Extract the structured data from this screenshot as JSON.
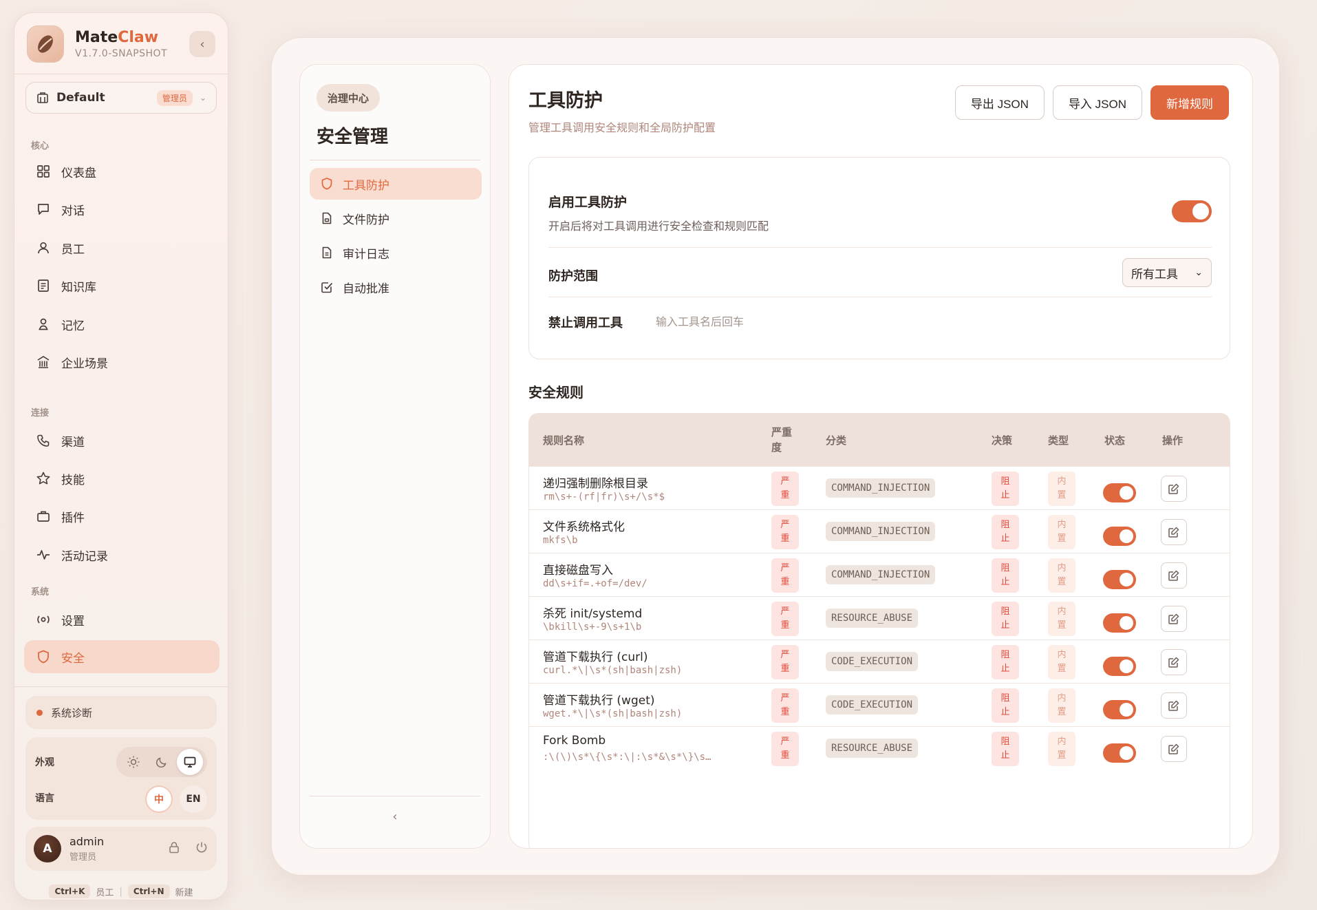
{
  "brand": {
    "name_a": "Mate",
    "name_b": "Claw",
    "version": "V1.7.0-SNAPSHOT"
  },
  "workspace": {
    "name": "Default",
    "badge": "管理员"
  },
  "nav": {
    "section_core": "核心",
    "section_connect": "连接",
    "section_system": "系统",
    "items": [
      {
        "label": "仪表盘",
        "icon": "grid-icon"
      },
      {
        "label": "对话",
        "icon": "chat-icon"
      },
      {
        "label": "员工",
        "icon": "person-icon"
      },
      {
        "label": "知识库",
        "icon": "book-icon"
      },
      {
        "label": "记忆",
        "icon": "memory-icon"
      },
      {
        "label": "企业场景",
        "icon": "building-icon"
      },
      {
        "label": "渠道",
        "icon": "phone-icon"
      },
      {
        "label": "技能",
        "icon": "star-icon"
      },
      {
        "label": "插件",
        "icon": "plugin-icon"
      },
      {
        "label": "活动记录",
        "icon": "activity-icon"
      },
      {
        "label": "设置",
        "icon": "settings-icon"
      },
      {
        "label": "安全",
        "icon": "shield-icon"
      }
    ]
  },
  "diagnostics": {
    "label": "系统诊断"
  },
  "prefs": {
    "appearance_label": "外观",
    "language_label": "语言",
    "lang_zh": "中",
    "lang_en": "EN"
  },
  "user": {
    "initial": "A",
    "name": "admin",
    "role": "管理员"
  },
  "shortcuts": {
    "k1": "Ctrl+K",
    "k1_label": "员工",
    "k2": "Ctrl+N",
    "k2_label": "新建"
  },
  "subnav": {
    "chip": "治理中心",
    "title": "安全管理",
    "items": [
      {
        "label": "工具防护"
      },
      {
        "label": "文件防护"
      },
      {
        "label": "审计日志"
      },
      {
        "label": "自动批准"
      }
    ]
  },
  "page": {
    "title": "工具防护",
    "subtitle": "管理工具调用安全规则和全局防护配置",
    "export_label": "导出 JSON",
    "import_label": "导入 JSON",
    "add_label": "新增规则"
  },
  "settings": {
    "enable_title": "启用工具防护",
    "enable_desc": "开启后将对工具调用进行安全检查和规则匹配",
    "scope_label": "防护范围",
    "scope_value": "所有工具",
    "ban_label": "禁止调用工具",
    "ban_placeholder": "输入工具名后回车"
  },
  "rules": {
    "title": "安全规则",
    "columns": {
      "name": "规则名称",
      "severity_a": "严重",
      "severity_b": "度",
      "category": "分类",
      "decision": "决策",
      "type": "类型",
      "status": "状态",
      "actions": "操作"
    },
    "rows": [
      {
        "name": "递归强制删除根目录",
        "pattern": "rm\\s+-(rf|fr)\\s+/\\s*$",
        "sev_a": "严",
        "sev_b": "重",
        "category": "COMMAND_INJECTION",
        "dec_a": "阻",
        "dec_b": "止",
        "type_a": "内",
        "type_b": "置"
      },
      {
        "name": "文件系统格式化",
        "pattern": "mkfs\\b",
        "sev_a": "严",
        "sev_b": "重",
        "category": "COMMAND_INJECTION",
        "dec_a": "阻",
        "dec_b": "止",
        "type_a": "内",
        "type_b": "置"
      },
      {
        "name": "直接磁盘写入",
        "pattern": "dd\\s+if=.+of=/dev/",
        "sev_a": "严",
        "sev_b": "重",
        "category": "COMMAND_INJECTION",
        "dec_a": "阻",
        "dec_b": "止",
        "type_a": "内",
        "type_b": "置"
      },
      {
        "name": "杀死 init/systemd",
        "pattern": "\\bkill\\s+-9\\s+1\\b",
        "sev_a": "严",
        "sev_b": "重",
        "category": "RESOURCE_ABUSE",
        "dec_a": "阻",
        "dec_b": "止",
        "type_a": "内",
        "type_b": "置"
      },
      {
        "name": "管道下载执行 (curl)",
        "pattern": "curl.*\\|\\s*(sh|bash|zsh)",
        "sev_a": "严",
        "sev_b": "重",
        "category": "CODE_EXECUTION",
        "dec_a": "阻",
        "dec_b": "止",
        "type_a": "内",
        "type_b": "置"
      },
      {
        "name": "管道下载执行 (wget)",
        "pattern": "wget.*\\|\\s*(sh|bash|zsh)",
        "sev_a": "严",
        "sev_b": "重",
        "category": "CODE_EXECUTION",
        "dec_a": "阻",
        "dec_b": "止",
        "type_a": "内",
        "type_b": "置"
      },
      {
        "name": "Fork Bomb",
        "pattern": ":\\(\\)\\s*\\{\\s*:\\|:\\s*&\\s*\\}\\s…",
        "sev_a": "严",
        "sev_b": "重",
        "category": "RESOURCE_ABUSE",
        "dec_a": "阻",
        "dec_b": "止",
        "type_a": "内",
        "type_b": "置"
      }
    ]
  },
  "colors": {
    "accent": "#e0683e",
    "danger": "#e14a3a"
  }
}
